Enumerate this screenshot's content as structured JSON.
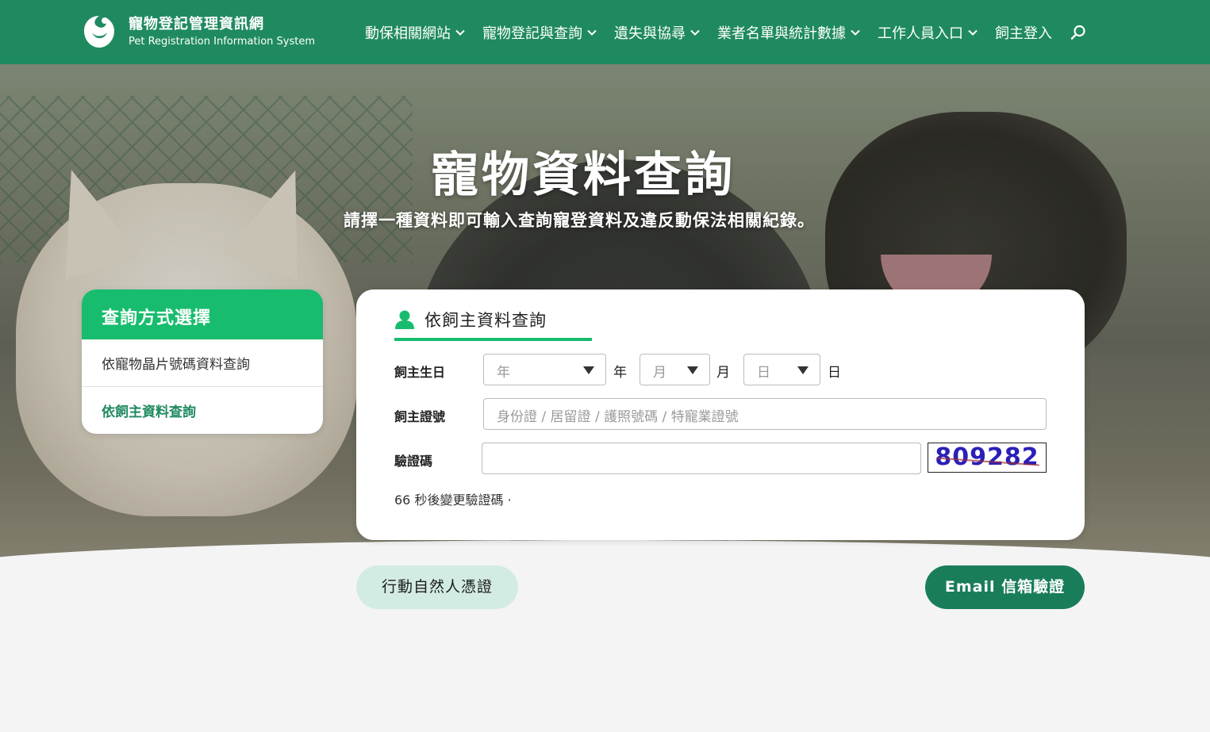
{
  "header": {
    "title": "寵物登記管理資訊網",
    "subtitle": "Pet Registration Information System",
    "nav": [
      {
        "label": "動保相關網站"
      },
      {
        "label": "寵物登記與查詢"
      },
      {
        "label": "遺失與協尋"
      },
      {
        "label": "業者名單與統計數據"
      },
      {
        "label": "工作人員入口"
      },
      {
        "label": "飼主登入"
      }
    ],
    "search_icon": "search-icon"
  },
  "hero": {
    "title": "寵物資料查詢",
    "subtitle": "請擇一種資料即可輸入查詢寵登資料及違反動保法相關紀錄。"
  },
  "sidebar": {
    "heading": "查詢方式選擇",
    "items": [
      {
        "label": "依寵物晶片號碼資料查詢"
      },
      {
        "label": "依飼主資料查詢"
      }
    ]
  },
  "form": {
    "tab_label": "依飼主資料查詢",
    "birthday_label": "飼主生日",
    "year_placeholder": "年",
    "year_unit": "年",
    "month_placeholder": "月",
    "month_unit": "月",
    "day_placeholder": "日",
    "day_unit": "日",
    "id_label": "飼主證號",
    "id_placeholder": "身份證 / 居留證 / 護照號碼 / 特寵業證號",
    "captcha_label": "驗證碼",
    "captcha_value": "",
    "captcha_code": "809282",
    "countdown": "66 秒後變更驗證碼 ·"
  },
  "buttons": {
    "citizen": "行動自然人憑證",
    "email": "Email 信箱驗證"
  },
  "colors": {
    "header_bg": "#1f8a5f",
    "accent_green": "#18bc6e",
    "email_button": "#1a7d5a",
    "citizen_button": "#d3ece3"
  }
}
